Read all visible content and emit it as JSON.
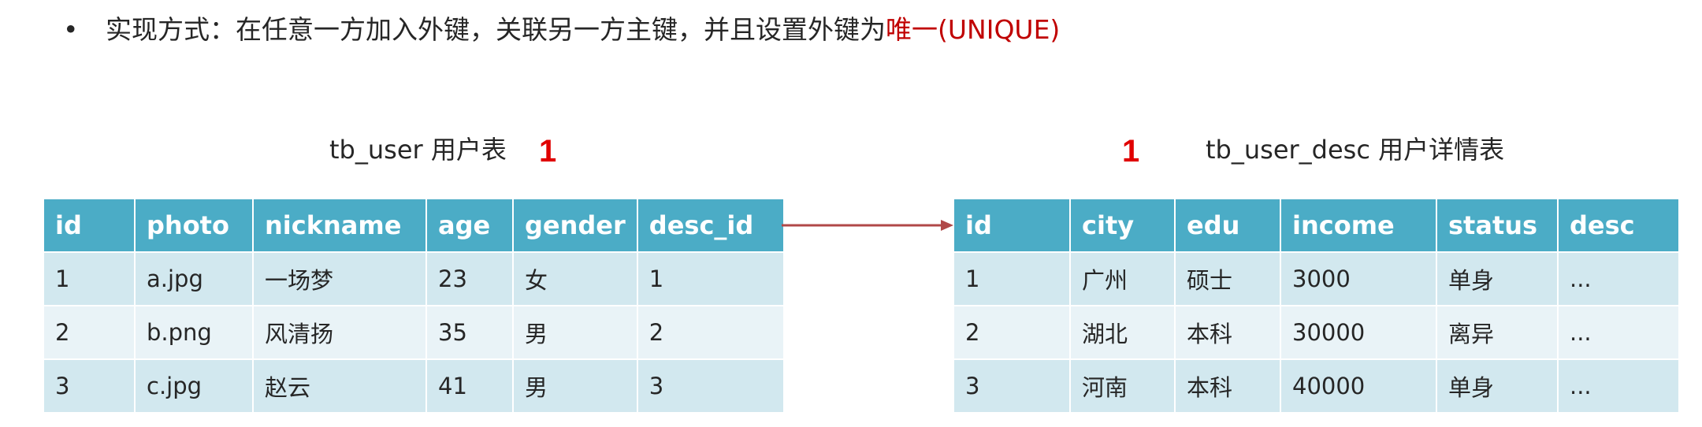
{
  "bullet": {
    "dot": "•",
    "text": "实现方式：在任意一方加入外键，关联另一方主键，并且设置外键为",
    "highlight": "唯一(UNIQUE)",
    "highlight_color": "#c00000"
  },
  "left_table": {
    "caption": "tb_user 用户表",
    "cardinality": "1",
    "columns": [
      "id",
      "photo",
      "nickname",
      "age",
      "gender",
      "desc_id"
    ],
    "rows": [
      [
        "1",
        "a.jpg",
        "一场梦",
        "23",
        "女",
        "1"
      ],
      [
        "2",
        "b.png",
        "风清扬",
        "35",
        "男",
        "2"
      ],
      [
        "3",
        "c.jpg",
        "赵云",
        "41",
        "男",
        "3"
      ]
    ]
  },
  "right_table": {
    "caption": "tb_user_desc 用户详情表",
    "cardinality": "1",
    "columns": [
      "id",
      "city",
      "edu",
      "income",
      "status",
      "desc"
    ],
    "rows": [
      [
        "1",
        "广州",
        "硕士",
        "3000",
        "单身",
        "..."
      ],
      [
        "2",
        "湖北",
        "本科",
        "30000",
        "离异",
        "..."
      ],
      [
        "3",
        "河南",
        "本科",
        "40000",
        "单身",
        "..."
      ]
    ]
  },
  "colors": {
    "header_bg": "#4bacc6",
    "row_odd": "#d2e8ef",
    "row_even": "#e9f3f7",
    "arrow": "#b04848",
    "cardinality": "#e00000"
  }
}
